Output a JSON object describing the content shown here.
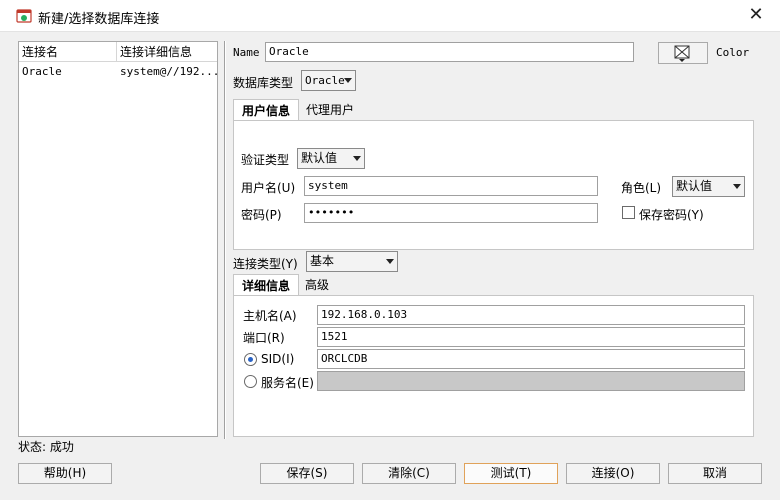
{
  "window": {
    "title": "新建/选择数据库连接"
  },
  "list": {
    "headers": [
      "连接名",
      "连接详细信息"
    ],
    "rows": [
      {
        "name": "Oracle",
        "detail": "system@//192...."
      }
    ]
  },
  "status": "状态: 成功",
  "form": {
    "name_label": "Name",
    "name_value": "Oracle",
    "color_label": "Color",
    "dbtype_label": "数据库类型",
    "dbtype_value": "Oracle",
    "auth_tabs": [
      "用户信息",
      "代理用户"
    ],
    "auth_type_label": "验证类型",
    "auth_type_value": "默认值",
    "username_label": "用户名(U)",
    "username_value": "system",
    "role_label": "角色(L)",
    "role_value": "默认值",
    "password_label": "密码(P)",
    "password_value": "•••••••",
    "save_password_label": "保存密码(Y)",
    "conn_type_label": "连接类型(Y)",
    "conn_type_value": "基本",
    "detail_tabs": [
      "详细信息",
      "高级"
    ],
    "host_label": "主机名(A)",
    "host_value": "192.168.0.103",
    "port_label": "端口(R)",
    "port_value": "1521",
    "sid_label": "SID(I)",
    "sid_value": "ORCLCDB",
    "service_label": "服务名(E)",
    "service_value": ""
  },
  "buttons": {
    "help": "帮助(H)",
    "save": "保存(S)",
    "clear": "清除(C)",
    "test": "测试(T)",
    "connect": "连接(O)",
    "cancel": "取消"
  },
  "colors": {
    "accent": "#2a63c4",
    "focus_border": "#e0a25a"
  }
}
